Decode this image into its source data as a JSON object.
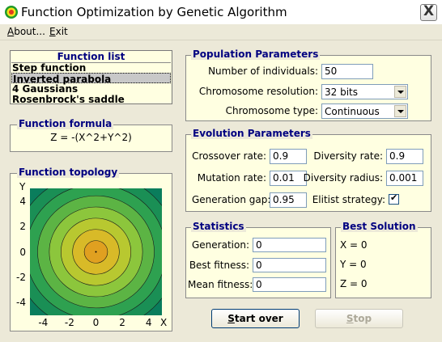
{
  "window": {
    "title": "Function Optimization by Genetic Algorithm",
    "close_label": "X"
  },
  "menu": [
    "About...",
    "Exit"
  ],
  "function_list": {
    "header": "Function list",
    "items": [
      "Step function",
      "Inverted parabola",
      "4 Gaussians",
      "Rosenbrock's saddle"
    ],
    "selected_index": 1
  },
  "function_formula": {
    "title": "Function formula",
    "formula": "Z = -(X^2+Y^2)"
  },
  "function_topology": {
    "title": "Function topology",
    "y_axis_label": "Y",
    "x_axis_label": "X",
    "y_ticks": [
      "4",
      "2",
      "0",
      "-2",
      "-4"
    ],
    "x_ticks": [
      "-4",
      "-2",
      "0",
      "2",
      "4"
    ],
    "x_range": [
      -5,
      5
    ],
    "y_range": [
      -5,
      5
    ],
    "contour_colors": [
      "#0a7d5c",
      "#1a8f55",
      "#2ea150",
      "#5cb444",
      "#8cc63c",
      "#b8c830",
      "#d8ba28",
      "#e0a020"
    ]
  },
  "population": {
    "title": "Population Parameters",
    "individuals_label": "Number of individuals:",
    "individuals_value": "50",
    "resolution_label": "Chromosome resolution:",
    "resolution_value": "32 bits",
    "type_label": "Chromosome type:",
    "type_value": "Continuous"
  },
  "evolution": {
    "title": "Evolution Parameters",
    "crossover_label": "Crossover rate:",
    "crossover_value": "0.9",
    "diversity_rate_label": "Diversity rate:",
    "diversity_rate_value": "0.9",
    "mutation_label": "Mutation rate:",
    "mutation_value": "0.01",
    "diversity_radius_label": "Diversity radius:",
    "diversity_radius_value": "0.001",
    "gap_label": "Generation gap:",
    "gap_value": "0.95",
    "elitist_label": "Elitist strategy:",
    "elitist_checked": true
  },
  "statistics": {
    "title": "Statistics",
    "generation_label": "Generation:",
    "generation_value": "0",
    "best_label": "Best fitness:",
    "best_value": "0",
    "mean_label": "Mean fitness:",
    "mean_value": "0"
  },
  "best_solution": {
    "title": "Best Solution",
    "x": "X = 0",
    "y": "Y = 0",
    "z": "Z = 0"
  },
  "buttons": {
    "start_over": "Start over",
    "stop": "Stop"
  }
}
